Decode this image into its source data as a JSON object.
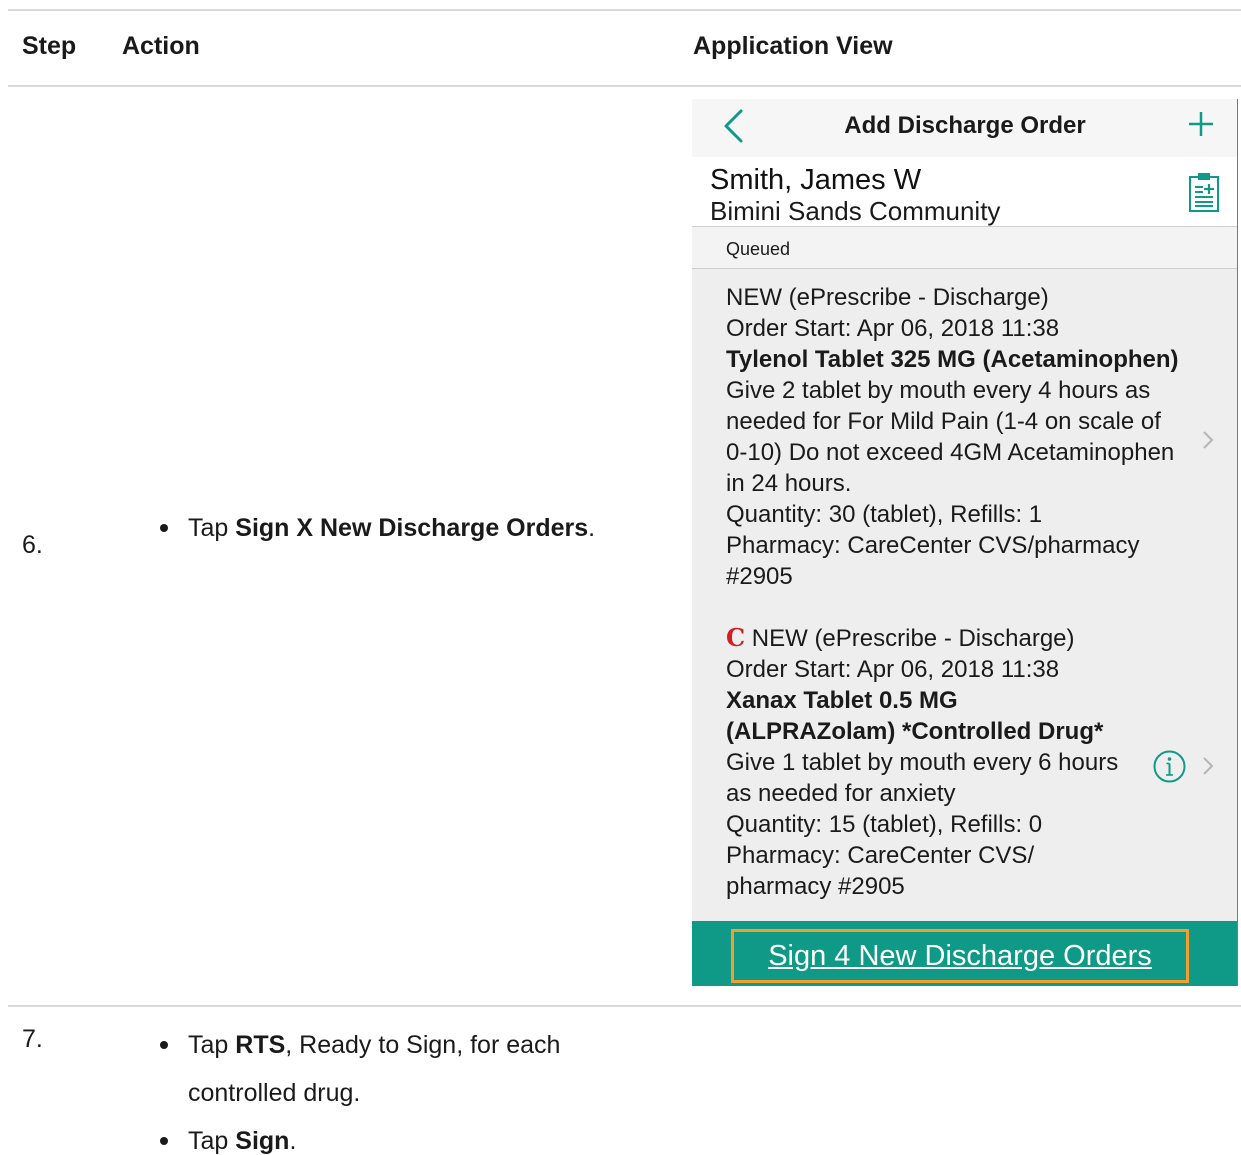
{
  "table": {
    "headers": {
      "step": "Step",
      "action": "Action",
      "view": "Application View"
    }
  },
  "rows": [
    {
      "step": "6.",
      "bullet": {
        "pre": "Tap ",
        "bold": "Sign X New Discharge Orders",
        "post": "."
      }
    },
    {
      "step": "7.",
      "bullets": [
        {
          "pre": "Tap ",
          "bold": "RTS",
          "post": ", Ready to Sign, for each controlled drug."
        },
        {
          "pre": "Tap ",
          "bold": "Sign",
          "post": "."
        }
      ]
    }
  ],
  "app": {
    "nav_title": "Add Discharge Order",
    "patient": {
      "name": "Smith, James W",
      "facility": "Bimini Sands Community"
    },
    "section_label": "Queued",
    "orders": [
      {
        "flag": "",
        "status": "NEW  (ePrescribe - Discharge)",
        "start": "Order Start: Apr 06, 2018 11:38",
        "drug_bold": "Tylenol Tablet 325 MG (Acetaminophen)",
        "instructions": " Give 2 tablet by mouth every 4 hours as needed for For Mild Pain (1-4 on scale of 0-10) Do not exceed 4GM Acetaminophen in 24 hours.",
        "qty": "Quantity: 30 (tablet),    Refills: 1",
        "pharmacy": "Pharmacy: CareCenter CVS/pharmacy #2905"
      },
      {
        "flag": "C",
        "status": " NEW  (ePrescribe - Discharge)",
        "start": "Order Start: Apr 06, 2018 11:38",
        "drug_bold": "Xanax Tablet 0.5 MG (ALPRAZolam) *Controlled Drug*",
        "instructions": "Give 1 tablet by mouth every 6 hours as needed for anxiety",
        "qty": "Quantity: 15 (tablet),    Refills: 0",
        "pharmacy": "Pharmacy: CareCenter CVS/ pharmacy #2905"
      }
    ],
    "sign_button": "Sign 4 New Discharge Orders"
  },
  "colors": {
    "accent": "#0f9a87",
    "highlight": "#f0a030",
    "controlled": "#d21f1f"
  },
  "icons": [
    "back-chevron-icon",
    "plus-icon",
    "clipboard-icon",
    "chevron-right-icon",
    "info-icon"
  ]
}
